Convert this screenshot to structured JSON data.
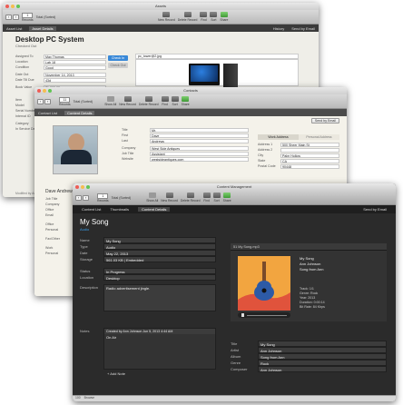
{
  "colors": {
    "accent": "#3a89d8",
    "dark_bg": "#2b2b2b",
    "tab_bar": "#3a3a3a",
    "art_orange": "#f2a540"
  },
  "assets": {
    "title": "Assets",
    "toolbar": {
      "records_label": "Records",
      "count": "1",
      "total": "Total (Sorted)",
      "new_label": "New Record",
      "delete_label": "Delete Record",
      "find_label": "Find",
      "sort_label": "Sort",
      "share_label": "Share"
    },
    "tabs": [
      "Asset List",
      "Asset Details"
    ],
    "right_tabs": [
      "History",
      "Send by Email"
    ],
    "heading": "Desktop PC System",
    "status": "Checked Out",
    "fields": [
      {
        "label": "Assigned To",
        "value": "Max Thomas"
      },
      {
        "label": "Location",
        "value": "Lab 18"
      },
      {
        "label": "Condition",
        "value": "Good"
      },
      {
        "label": "Date Out",
        "value": "November 14, 2013"
      },
      {
        "label": "Date Till Due",
        "value": "43d"
      },
      {
        "label": "Book Value",
        "value": "$1,000.00"
      },
      {
        "label": "Item",
        "value": ""
      },
      {
        "label": "Model",
        "value": ""
      },
      {
        "label": "Serial Number",
        "value": ""
      },
      {
        "label": "Internal ID",
        "value": ""
      },
      {
        "label": "Category",
        "value": ""
      },
      {
        "label": "In Service Date",
        "value": ""
      }
    ],
    "check_in_label": "Check In",
    "check_out_label": "Check Out",
    "image_name": "pc_tower@2.jpg",
    "modified": "Modified by Admin",
    "browse": "Browse"
  },
  "contacts": {
    "title": "Contacts",
    "toolbar": {
      "records_label": "Records",
      "count": "11",
      "total": "Total (Sorted)",
      "show_all": "Show All",
      "new_label": "New Record",
      "delete_label": "Delete Record",
      "find_label": "Find",
      "sort_label": "Sort",
      "share_label": "Share"
    },
    "tabs": [
      "Contact List",
      "Content Details"
    ],
    "send_email": "Send by Email",
    "fields": [
      {
        "label": "Title",
        "value": "Mr."
      },
      {
        "label": "First",
        "value": "Dave"
      },
      {
        "label": "Last",
        "value": "Andrews"
      },
      {
        "label": "Company",
        "value": "West Side Antiques"
      },
      {
        "label": "Job Title",
        "value": "Assistant"
      },
      {
        "label": "Website",
        "value": "westsideantiques.com"
      }
    ],
    "address_tabs": [
      "Work Address",
      "Personal Address"
    ],
    "address": [
      {
        "label": "Address 1",
        "value": "500 Sheer Main St"
      },
      {
        "label": "Address 2",
        "value": ""
      },
      {
        "label": "City",
        "value": "Palm Hollow"
      },
      {
        "label": "State",
        "value": "CA"
      },
      {
        "label": "Postal Code",
        "value": "90448"
      }
    ],
    "left_labels": [
      "Job Title",
      "Company",
      "Office",
      "Email",
      "Office",
      "Personal",
      "Fax/Other",
      "Work",
      "Personal"
    ],
    "name_partial": "Dave Andrews"
  },
  "content": {
    "title": "Content Management",
    "toolbar": {
      "records_label": "Records",
      "count": "1",
      "total": "Total (Sorted)",
      "show_all": "Show All",
      "new_label": "New Record",
      "delete_label": "Delete Record",
      "find_label": "Find",
      "sort_label": "Sort",
      "share_label": "Share"
    },
    "tabs": [
      "Content List",
      "Thumbnails",
      "Content Details"
    ],
    "send_email": "Send by Email",
    "heading": "My Song",
    "kind": "Audio",
    "fields": [
      {
        "label": "Name",
        "value": "My Song"
      },
      {
        "label": "Type",
        "value": "Audio"
      },
      {
        "label": "Date",
        "value": "May 22, 2013"
      },
      {
        "label": "Storage",
        "value": "561.03 KB | Embedded"
      }
    ],
    "fields2": [
      {
        "label": "Status",
        "value": "In Progress"
      },
      {
        "label": "Location",
        "value": "Desktop"
      }
    ],
    "description_label": "Description",
    "description": "Radio advertisement jingle.",
    "notes_label": "Notes",
    "note_author": "Created by Ann Johnson Jun 5, 2013 4:44 AM",
    "note_text": "On Air",
    "add_note": "Add Note",
    "file_name": "51 My Song.mp3",
    "track_artist": "Ann Johnson",
    "track_title": "Song from Ann",
    "meta": [
      {
        "label": "Track:",
        "value": "1/1"
      },
      {
        "label": "Genre:",
        "value": "Rock"
      },
      {
        "label": "Year:",
        "value": "2013"
      },
      {
        "label": "Duration:",
        "value": "0:00:14"
      },
      {
        "label": "Bit Rate:",
        "value": "84 Kbps"
      }
    ],
    "tags": [
      {
        "label": "Title",
        "value": "My Song"
      },
      {
        "label": "Artist",
        "value": "Ann Johnson"
      },
      {
        "label": "Album",
        "value": "Song from Ann"
      },
      {
        "label": "Genre",
        "value": "Rock"
      },
      {
        "label": "Composer",
        "value": "Ann Johnson"
      }
    ],
    "zoom": "100",
    "browse": "Browse"
  }
}
